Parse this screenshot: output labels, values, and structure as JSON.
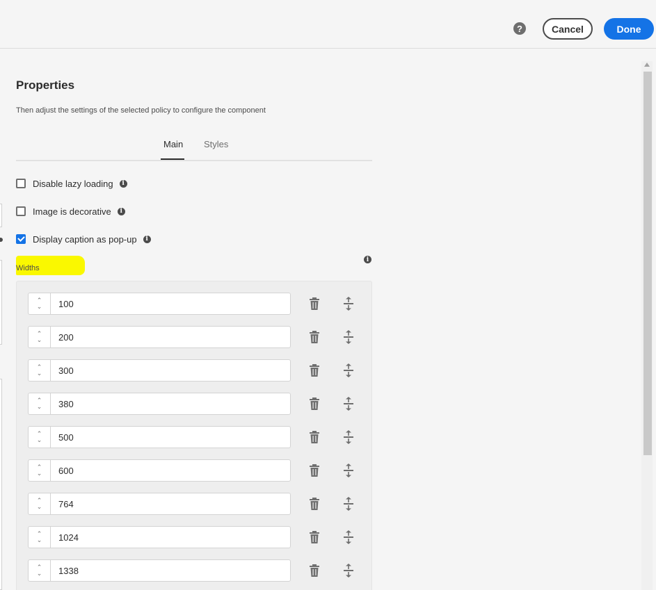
{
  "header": {
    "help_icon": "help-icon",
    "help_glyph": "?",
    "cancel_label": "Cancel",
    "done_label": "Done"
  },
  "dialog": {
    "title": "Properties",
    "subtitle": "Then adjust the settings of the selected policy to configure the component"
  },
  "tabs": [
    {
      "label": "Main",
      "selected": true
    },
    {
      "label": "Styles",
      "selected": false
    }
  ],
  "options": [
    {
      "label": "Disable lazy loading",
      "checked": false
    },
    {
      "label": "Image is decorative",
      "checked": false
    },
    {
      "label": "Display caption as pop-up",
      "checked": true
    }
  ],
  "widths": {
    "label": "Widths",
    "values": [
      "100",
      "200",
      "300",
      "380",
      "500",
      "600",
      "764",
      "1024",
      "1338"
    ]
  },
  "colors": {
    "accent": "#1473e6",
    "highlight": "#faf800"
  }
}
